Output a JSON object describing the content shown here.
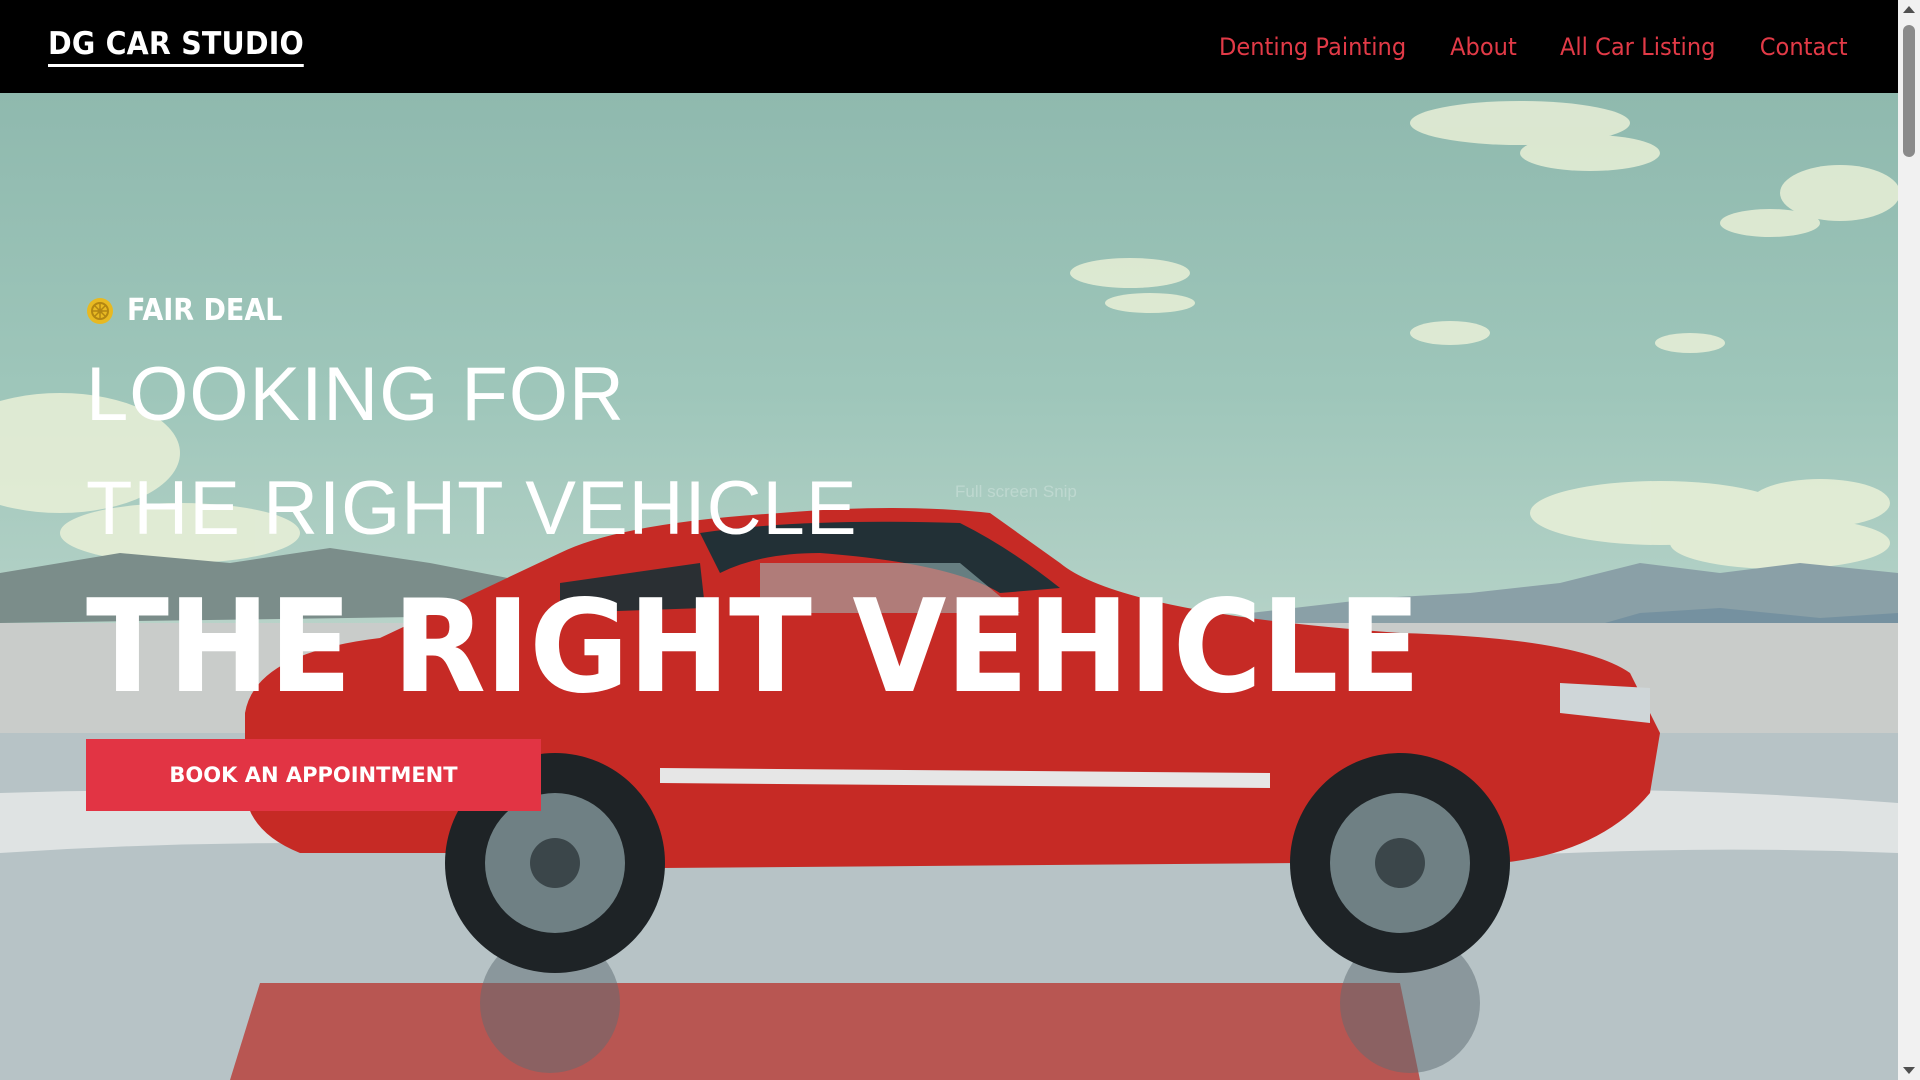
{
  "nav": {
    "brand": "DG CAR STUDIO",
    "links": [
      "Denting Painting",
      "About",
      "All Car Listing",
      "Contact"
    ]
  },
  "hero": {
    "badge": "FAIR DEAL",
    "badge_icon": "wheel-icon",
    "line1": "LOOKING FOR",
    "line2": "THE RIGHT VEHICLE",
    "line3": "THE RIGHT VEHICLE",
    "cta": "BOOK AN APPOINTMENT",
    "overlay_text": "Full screen Snip"
  },
  "colors": {
    "nav_bg": "#000000",
    "nav_link": "#e23a47",
    "cta_bg": "#e23444",
    "badge_icon": "#e8b921"
  }
}
